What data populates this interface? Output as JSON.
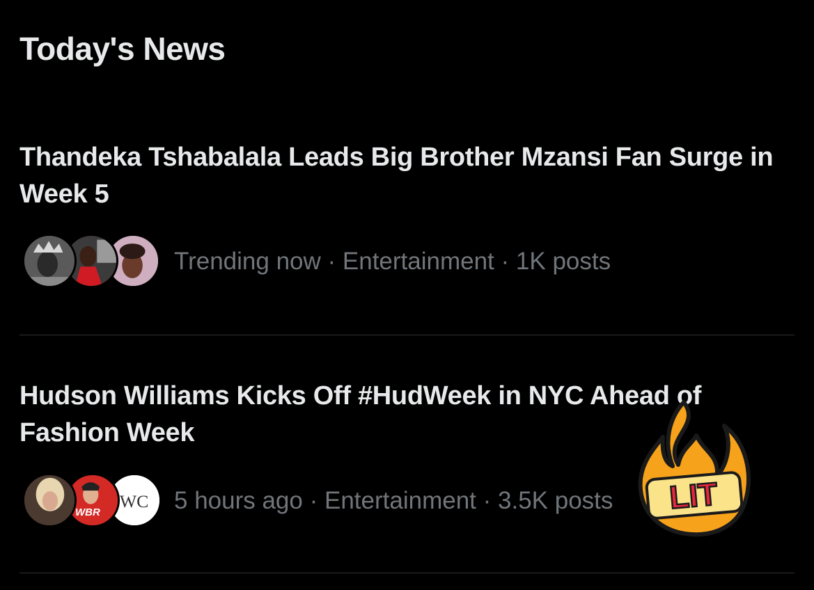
{
  "section": {
    "title": "Today's News"
  },
  "news": [
    {
      "headline": "Thandeka Tshabalala Leads Big Brother Mzansi Fan Surge in Week 5",
      "time": "Trending now",
      "category": "Entertainment",
      "posts": "1K posts",
      "separator": " · "
    },
    {
      "headline": "Hudson Williams Kicks Off #HudWeek in NYC Ahead of Fashion Week",
      "time": "5 hours ago",
      "category": "Entertainment",
      "posts": "3.5K posts",
      "separator": " · ",
      "avatar_badge": "WBR"
    }
  ],
  "sticker": {
    "label": "LIT",
    "icon": "fire-icon"
  },
  "colors": {
    "background": "#000000",
    "text_primary": "#e7e9ea",
    "text_secondary": "#71767b",
    "divider": "#2f3336",
    "fire_orange": "#f7a21b",
    "lit_red": "#e8273f"
  }
}
